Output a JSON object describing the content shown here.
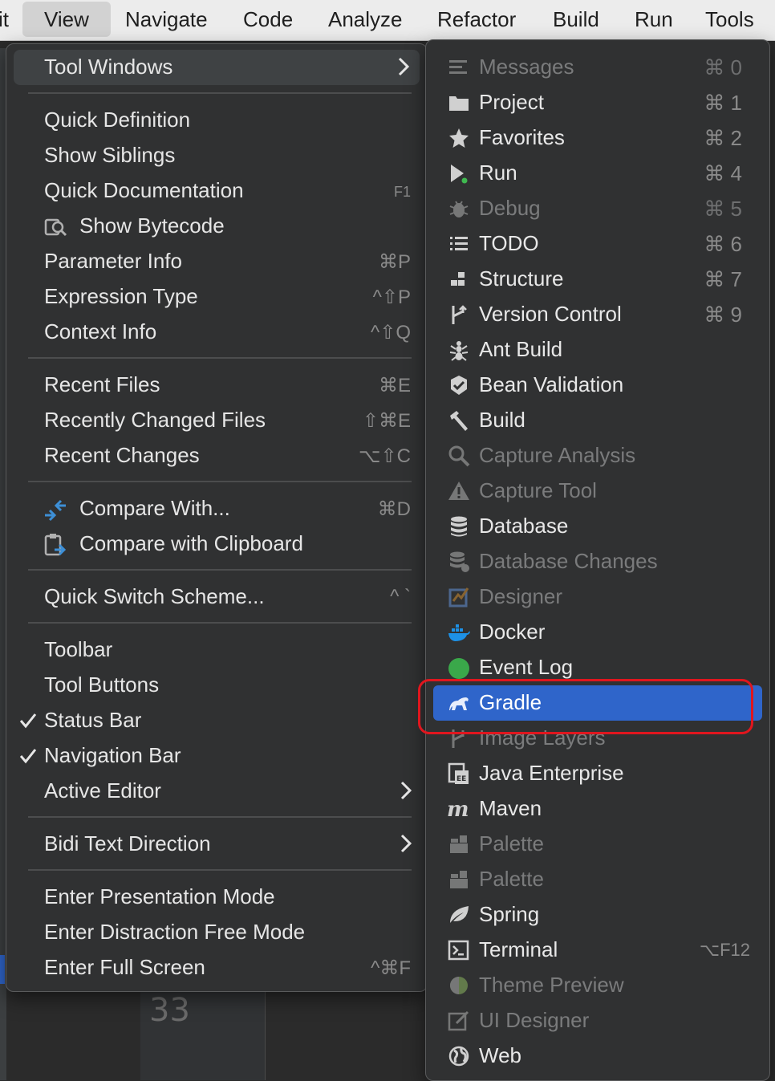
{
  "menubar": {
    "items": [
      "it",
      "View",
      "Navigate",
      "Code",
      "Analyze",
      "Refactor",
      "Build",
      "Run",
      "Tools"
    ]
  },
  "view_menu": {
    "items": [
      {
        "label": "Tool Windows",
        "submenu": true,
        "highlighted": true
      },
      {
        "label": "Quick Definition"
      },
      {
        "label": "Show Siblings"
      },
      {
        "label": "Quick Documentation",
        "shortcut": "F1"
      },
      {
        "label": "Show Bytecode",
        "icon": "bytecode-icon"
      },
      {
        "label": "Parameter Info",
        "shortcut": "⌘P"
      },
      {
        "label": "Expression Type",
        "shortcut": "^⇧P"
      },
      {
        "label": "Context Info",
        "shortcut": "^⇧Q"
      },
      {
        "label": "Recent Files",
        "shortcut": "⌘E"
      },
      {
        "label": "Recently Changed Files",
        "shortcut": "⇧⌘E"
      },
      {
        "label": "Recent Changes",
        "shortcut": "⌥⇧C"
      },
      {
        "label": "Compare With...",
        "shortcut": "⌘D",
        "icon": "compare-icon"
      },
      {
        "label": "Compare with Clipboard",
        "icon": "clipboard-compare-icon"
      },
      {
        "label": "Quick Switch Scheme...",
        "shortcut": "^ `"
      },
      {
        "label": "Toolbar"
      },
      {
        "label": "Tool Buttons"
      },
      {
        "label": "Status Bar",
        "checked": true
      },
      {
        "label": "Navigation Bar",
        "checked": true
      },
      {
        "label": "Active Editor",
        "submenu": true
      },
      {
        "label": "Bidi Text Direction",
        "submenu": true
      },
      {
        "label": "Enter Presentation Mode"
      },
      {
        "label": "Enter Distraction Free Mode"
      },
      {
        "label": "Enter Full Screen",
        "shortcut": "^⌘F"
      }
    ]
  },
  "tool_windows_menu": {
    "items": [
      {
        "label": "Messages",
        "shortcut": "⌘ 0",
        "icon": "messages-icon",
        "enabled": false
      },
      {
        "label": "Project",
        "shortcut": "⌘ 1",
        "icon": "folder-icon",
        "enabled": true
      },
      {
        "label": "Favorites",
        "shortcut": "⌘ 2",
        "icon": "star-icon",
        "enabled": true
      },
      {
        "label": "Run",
        "shortcut": "⌘ 4",
        "icon": "run-icon",
        "enabled": true
      },
      {
        "label": "Debug",
        "shortcut": "⌘ 5",
        "icon": "bug-icon",
        "enabled": false
      },
      {
        "label": "TODO",
        "shortcut": "⌘ 6",
        "icon": "list-icon",
        "enabled": true
      },
      {
        "label": "Structure",
        "shortcut": "⌘ 7",
        "icon": "structure-icon",
        "enabled": true
      },
      {
        "label": "Version Control",
        "shortcut": "⌘ 9",
        "icon": "vcs-icon",
        "enabled": true
      },
      {
        "label": "Ant Build",
        "icon": "ant-icon",
        "enabled": true
      },
      {
        "label": "Bean Validation",
        "icon": "bean-icon",
        "enabled": true
      },
      {
        "label": "Build",
        "icon": "hammer-icon",
        "enabled": true
      },
      {
        "label": "Capture Analysis",
        "icon": "magnifier-icon",
        "enabled": false
      },
      {
        "label": "Capture Tool",
        "icon": "warning-icon",
        "enabled": false
      },
      {
        "label": "Database",
        "icon": "database-icon",
        "enabled": true
      },
      {
        "label": "Database Changes",
        "icon": "database-changes-icon",
        "enabled": false
      },
      {
        "label": "Designer",
        "icon": "designer-icon",
        "enabled": false
      },
      {
        "label": "Docker",
        "icon": "docker-icon",
        "enabled": true
      },
      {
        "label": "Event Log",
        "icon": "event-log-icon",
        "enabled": true
      },
      {
        "label": "Gradle",
        "icon": "gradle-icon",
        "enabled": true,
        "selected": true
      },
      {
        "label": "Image Layers",
        "icon": "image-layers-icon",
        "enabled": false
      },
      {
        "label": "Java Enterprise",
        "icon": "java-enterprise-icon",
        "enabled": true
      },
      {
        "label": "Maven",
        "icon": "maven-icon",
        "enabled": true
      },
      {
        "label": "Palette",
        "icon": "palette-icon",
        "enabled": false
      },
      {
        "label": "Palette",
        "icon": "palette-icon",
        "enabled": false
      },
      {
        "label": "Spring",
        "icon": "spring-icon",
        "enabled": true
      },
      {
        "label": "Terminal",
        "shortcut": "⌥F12",
        "icon": "terminal-icon",
        "enabled": true
      },
      {
        "label": "Theme Preview",
        "icon": "theme-preview-icon",
        "enabled": false
      },
      {
        "label": "UI Designer",
        "icon": "ui-designer-icon",
        "enabled": false
      },
      {
        "label": "Web",
        "icon": "globe-icon",
        "enabled": true
      }
    ]
  },
  "editor": {
    "line_number": "33"
  },
  "colors": {
    "selection": "#2f65ca",
    "highlight_box": "#e0161e",
    "menu_bg": "#303132",
    "docker": "#1d91e6",
    "event_log": "#3aa84a"
  }
}
